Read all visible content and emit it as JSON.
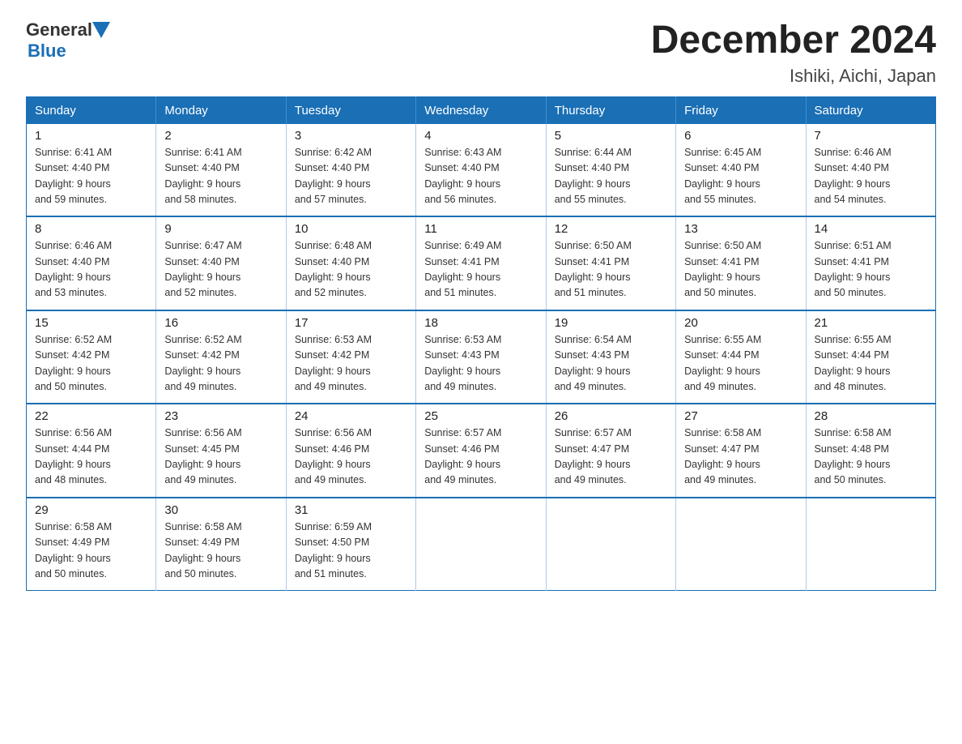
{
  "header": {
    "title": "December 2024",
    "subtitle": "Ishiki, Aichi, Japan",
    "logo_general": "General",
    "logo_blue": "Blue"
  },
  "days_of_week": [
    "Sunday",
    "Monday",
    "Tuesday",
    "Wednesday",
    "Thursday",
    "Friday",
    "Saturday"
  ],
  "weeks": [
    [
      {
        "day": "1",
        "sunrise": "6:41 AM",
        "sunset": "4:40 PM",
        "daylight": "9 hours and 59 minutes."
      },
      {
        "day": "2",
        "sunrise": "6:41 AM",
        "sunset": "4:40 PM",
        "daylight": "9 hours and 58 minutes."
      },
      {
        "day": "3",
        "sunrise": "6:42 AM",
        "sunset": "4:40 PM",
        "daylight": "9 hours and 57 minutes."
      },
      {
        "day": "4",
        "sunrise": "6:43 AM",
        "sunset": "4:40 PM",
        "daylight": "9 hours and 56 minutes."
      },
      {
        "day": "5",
        "sunrise": "6:44 AM",
        "sunset": "4:40 PM",
        "daylight": "9 hours and 55 minutes."
      },
      {
        "day": "6",
        "sunrise": "6:45 AM",
        "sunset": "4:40 PM",
        "daylight": "9 hours and 55 minutes."
      },
      {
        "day": "7",
        "sunrise": "6:46 AM",
        "sunset": "4:40 PM",
        "daylight": "9 hours and 54 minutes."
      }
    ],
    [
      {
        "day": "8",
        "sunrise": "6:46 AM",
        "sunset": "4:40 PM",
        "daylight": "9 hours and 53 minutes."
      },
      {
        "day": "9",
        "sunrise": "6:47 AM",
        "sunset": "4:40 PM",
        "daylight": "9 hours and 52 minutes."
      },
      {
        "day": "10",
        "sunrise": "6:48 AM",
        "sunset": "4:40 PM",
        "daylight": "9 hours and 52 minutes."
      },
      {
        "day": "11",
        "sunrise": "6:49 AM",
        "sunset": "4:41 PM",
        "daylight": "9 hours and 51 minutes."
      },
      {
        "day": "12",
        "sunrise": "6:50 AM",
        "sunset": "4:41 PM",
        "daylight": "9 hours and 51 minutes."
      },
      {
        "day": "13",
        "sunrise": "6:50 AM",
        "sunset": "4:41 PM",
        "daylight": "9 hours and 50 minutes."
      },
      {
        "day": "14",
        "sunrise": "6:51 AM",
        "sunset": "4:41 PM",
        "daylight": "9 hours and 50 minutes."
      }
    ],
    [
      {
        "day": "15",
        "sunrise": "6:52 AM",
        "sunset": "4:42 PM",
        "daylight": "9 hours and 50 minutes."
      },
      {
        "day": "16",
        "sunrise": "6:52 AM",
        "sunset": "4:42 PM",
        "daylight": "9 hours and 49 minutes."
      },
      {
        "day": "17",
        "sunrise": "6:53 AM",
        "sunset": "4:42 PM",
        "daylight": "9 hours and 49 minutes."
      },
      {
        "day": "18",
        "sunrise": "6:53 AM",
        "sunset": "4:43 PM",
        "daylight": "9 hours and 49 minutes."
      },
      {
        "day": "19",
        "sunrise": "6:54 AM",
        "sunset": "4:43 PM",
        "daylight": "9 hours and 49 minutes."
      },
      {
        "day": "20",
        "sunrise": "6:55 AM",
        "sunset": "4:44 PM",
        "daylight": "9 hours and 49 minutes."
      },
      {
        "day": "21",
        "sunrise": "6:55 AM",
        "sunset": "4:44 PM",
        "daylight": "9 hours and 48 minutes."
      }
    ],
    [
      {
        "day": "22",
        "sunrise": "6:56 AM",
        "sunset": "4:44 PM",
        "daylight": "9 hours and 48 minutes."
      },
      {
        "day": "23",
        "sunrise": "6:56 AM",
        "sunset": "4:45 PM",
        "daylight": "9 hours and 49 minutes."
      },
      {
        "day": "24",
        "sunrise": "6:56 AM",
        "sunset": "4:46 PM",
        "daylight": "9 hours and 49 minutes."
      },
      {
        "day": "25",
        "sunrise": "6:57 AM",
        "sunset": "4:46 PM",
        "daylight": "9 hours and 49 minutes."
      },
      {
        "day": "26",
        "sunrise": "6:57 AM",
        "sunset": "4:47 PM",
        "daylight": "9 hours and 49 minutes."
      },
      {
        "day": "27",
        "sunrise": "6:58 AM",
        "sunset": "4:47 PM",
        "daylight": "9 hours and 49 minutes."
      },
      {
        "day": "28",
        "sunrise": "6:58 AM",
        "sunset": "4:48 PM",
        "daylight": "9 hours and 50 minutes."
      }
    ],
    [
      {
        "day": "29",
        "sunrise": "6:58 AM",
        "sunset": "4:49 PM",
        "daylight": "9 hours and 50 minutes."
      },
      {
        "day": "30",
        "sunrise": "6:58 AM",
        "sunset": "4:49 PM",
        "daylight": "9 hours and 50 minutes."
      },
      {
        "day": "31",
        "sunrise": "6:59 AM",
        "sunset": "4:50 PM",
        "daylight": "9 hours and 51 minutes."
      },
      null,
      null,
      null,
      null
    ]
  ],
  "labels": {
    "sunrise": "Sunrise:",
    "sunset": "Sunset:",
    "daylight": "Daylight:"
  }
}
